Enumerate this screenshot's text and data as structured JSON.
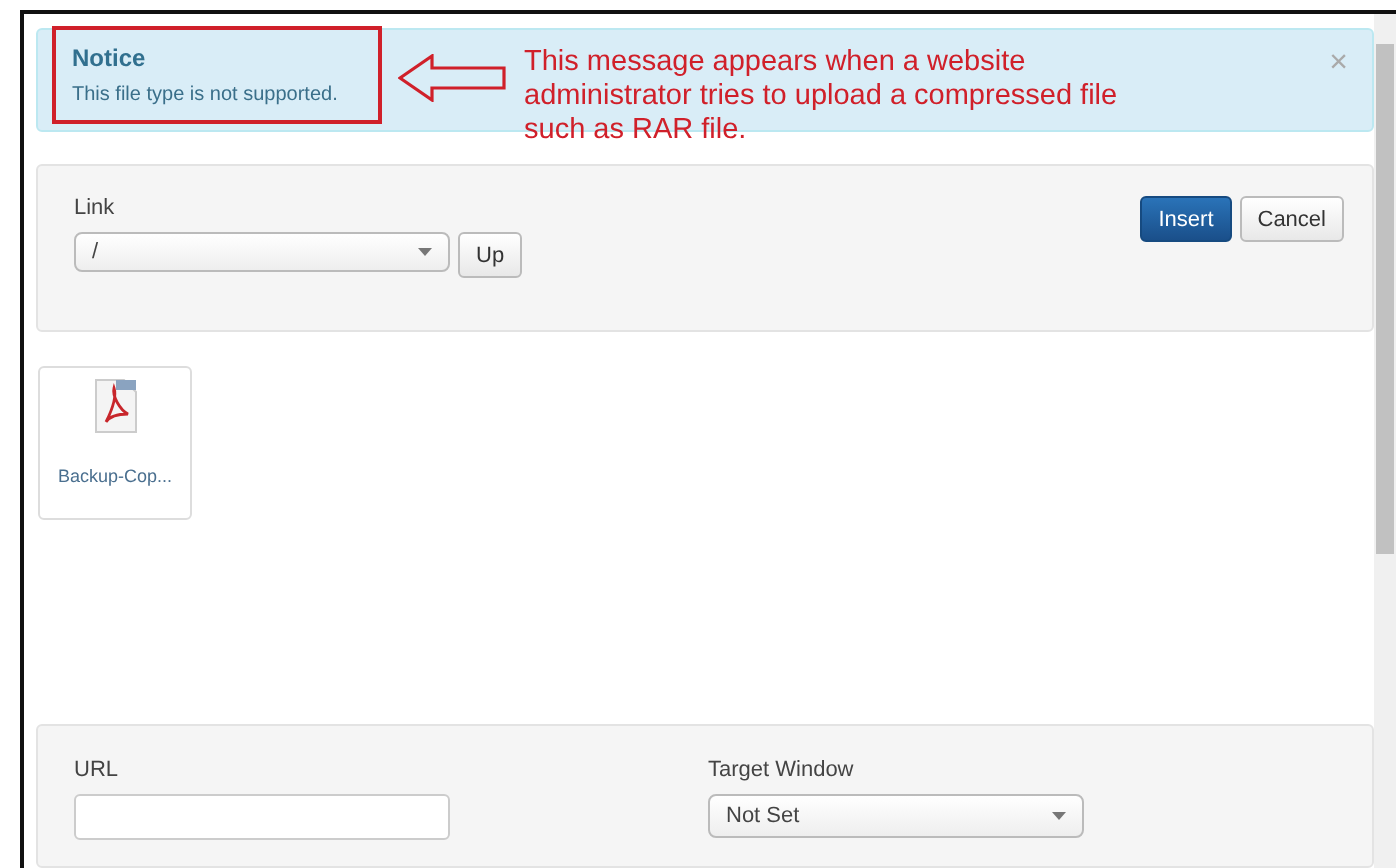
{
  "notice": {
    "title": "Notice",
    "message": "This file type is not supported.",
    "close": "×"
  },
  "annotation": {
    "text": "This message appears when a website administrator tries to upload a compressed file such as RAR file."
  },
  "link_panel": {
    "label": "Link",
    "folder": {
      "value": "/"
    },
    "up_button": "Up",
    "insert_button": "Insert",
    "cancel_button": "Cancel"
  },
  "files": [
    {
      "name": "Backup-Cop..."
    }
  ],
  "bottom_panel": {
    "url": {
      "label": "URL"
    },
    "target_window": {
      "label": "Target Window",
      "value": "Not Set"
    }
  }
}
